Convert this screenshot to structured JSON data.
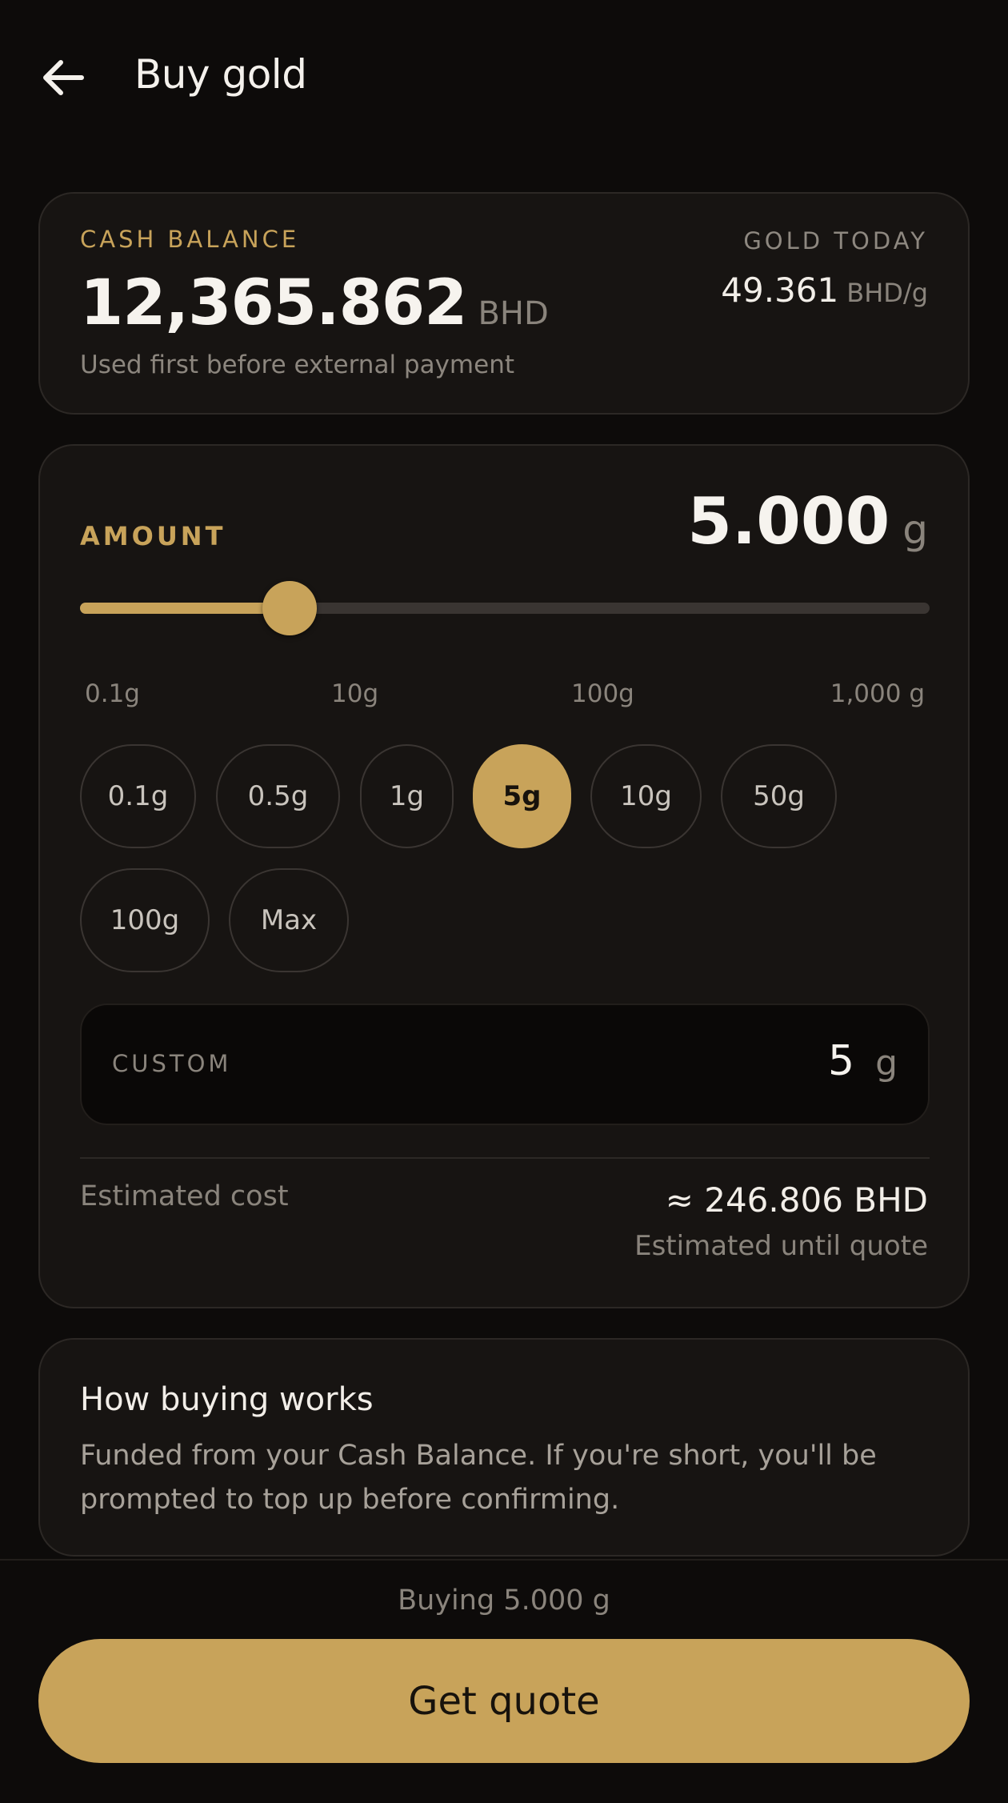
{
  "header": {
    "title": "Buy gold"
  },
  "balance": {
    "cash_label": "CASH BALANCE",
    "cash_value": "12,365.862",
    "cash_unit": "BHD",
    "cash_note": "Used first before external payment",
    "gold_label": "GOLD TODAY",
    "gold_value": "49.361",
    "gold_unit": "BHD/g"
  },
  "amount": {
    "label": "AMOUNT",
    "value": "5.000",
    "unit": "g",
    "slider_fraction": 0.247,
    "ticks": [
      "0.1g",
      "10g",
      "100g",
      "1,000 g"
    ],
    "chips": [
      "0.1g",
      "0.5g",
      "1g",
      "5g",
      "10g",
      "50g",
      "100g",
      "Max"
    ],
    "selected_chip": "5g",
    "custom_label": "CUSTOM",
    "custom_value": "5",
    "custom_unit": "g",
    "est_label": "Estimated cost",
    "est_value": "≈ 246.806 BHD",
    "est_note": "Estimated until quote"
  },
  "how": {
    "title": "How buying works",
    "body": "Funded from your Cash Balance. If you're short, you'll be prompted to top up before confirming."
  },
  "footer": {
    "note": "Buying 5.000 g",
    "cta_label": "Get quote"
  },
  "colors": {
    "accent": "#c8a35a",
    "background": "#0d0b0a",
    "card": "#171412"
  }
}
